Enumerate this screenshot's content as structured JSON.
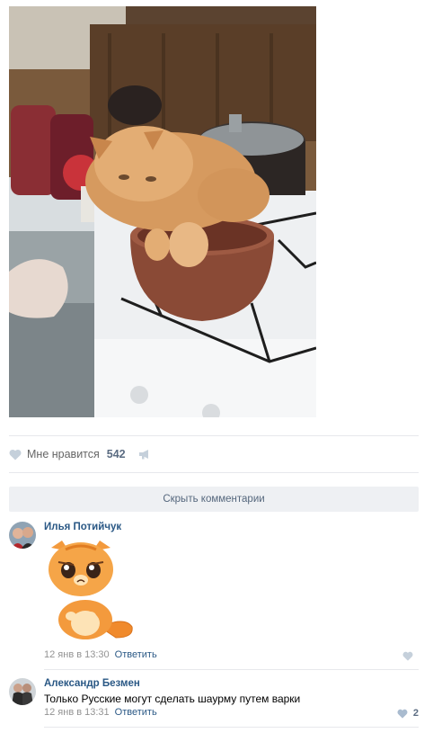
{
  "post": {
    "likes_label": "Мне нравится",
    "likes_count": "542"
  },
  "comments_toggle": "Скрыть комментарии",
  "comments": [
    {
      "author": "Илья Потийчук",
      "text": "",
      "time": "12 янв в 13:30",
      "reply_label": "Ответить",
      "likes": ""
    },
    {
      "author": "Александр Безмен",
      "text": "Только Русские могут сделать шаурму путем варки",
      "time": "12 янв в 13:31",
      "reply_label": "Ответить",
      "likes": "2"
    }
  ],
  "colors": {
    "link": "#2a5885",
    "muted": "#939393",
    "like_blue": "#5b6c82",
    "heart_grey": "#c5d0db",
    "toggle_bg": "#eef0f3"
  },
  "icons": [
    "heart-icon",
    "megaphone-icon"
  ]
}
